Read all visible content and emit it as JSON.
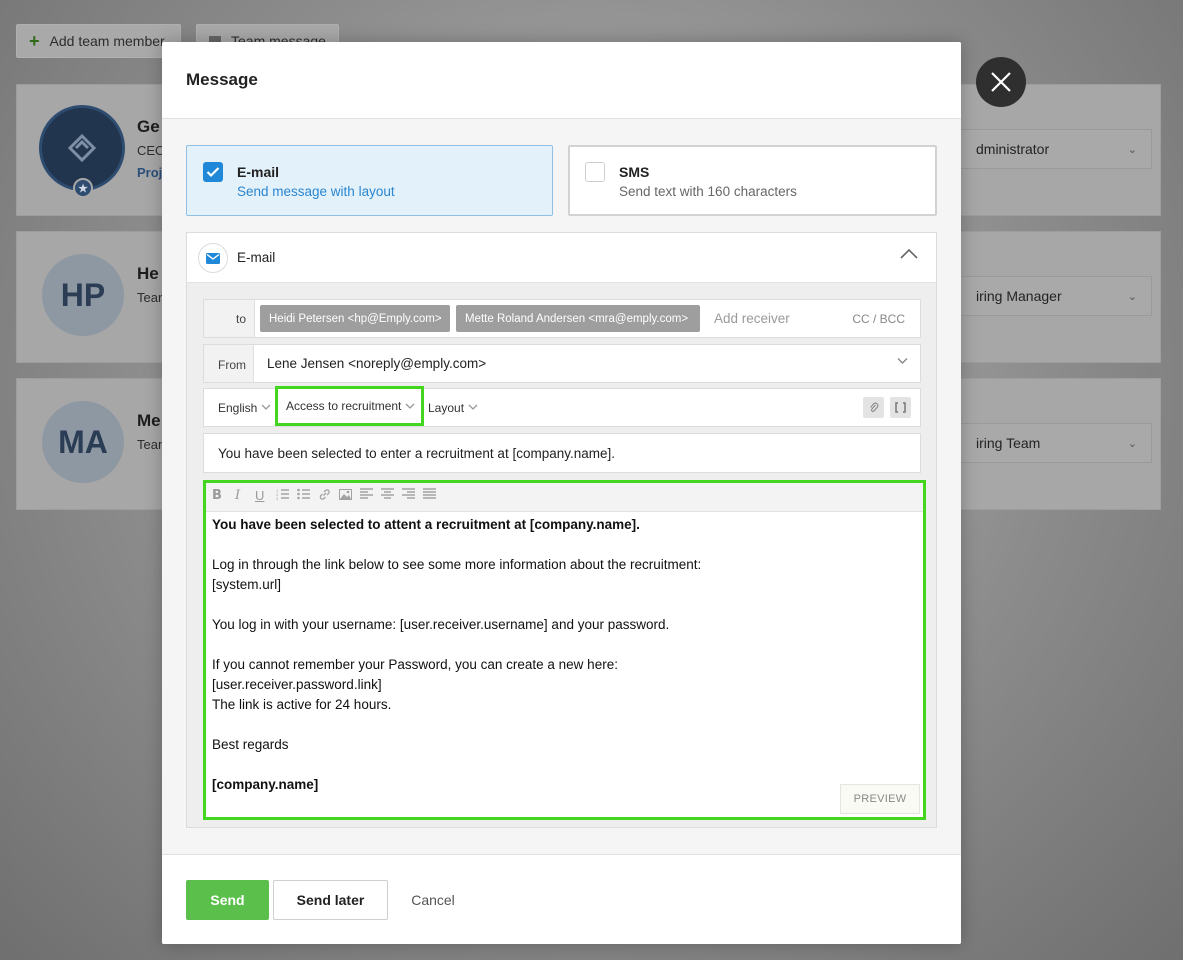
{
  "background": {
    "add_team_member": "Add team member",
    "team_message": "Team message",
    "members": [
      {
        "initials": "",
        "name": "Ge",
        "sub": "CEO",
        "link": "Proj",
        "role": "dministrator"
      },
      {
        "initials": "HP",
        "name": "He",
        "sub": "Tean",
        "link": "",
        "role": "iring Manager"
      },
      {
        "initials": "MA",
        "name": "Me",
        "sub": "Tean",
        "link": "",
        "role": "iring Team"
      }
    ]
  },
  "modal": {
    "title": "Message",
    "options": {
      "email": {
        "title": "E-mail",
        "desc": "Send message with layout",
        "checked": true
      },
      "sms": {
        "title": "SMS",
        "desc": "Send text with 160 characters",
        "checked": false
      }
    },
    "section_title": "E-mail",
    "to_label": "to",
    "recipients": [
      "Heidi Petersen <hp@Emply.com>",
      "Mette Roland Andersen <mra@emply.com>"
    ],
    "add_receiver_placeholder": "Add receiver",
    "cc_bcc": "CC / BCC",
    "from_label": "From",
    "from_value": "Lene Jensen <noreply@emply.com>",
    "language": "English",
    "template": "Access to recruitment",
    "layout": "Layout",
    "subject": "You have been selected to enter a recruitment at [company.name].",
    "body": {
      "line1": "You have been selected to attent a recruitment at [company.name].",
      "line2": "Log in through the link below to see some more information about the recruitment:",
      "line3": "[system.url]",
      "line4": "You log in with your username: [user.receiver.username] and your password.",
      "line5": "If you cannot remember your Password, you can create a new here:",
      "line6": "[user.receiver.password.link]",
      "line7": "The link is active for 24 hours.",
      "line8": "Best regards",
      "line9": "[company.name]"
    },
    "preview": "PREVIEW",
    "send": "Send",
    "send_later": "Send later",
    "cancel": "Cancel"
  },
  "colors": {
    "accent_green": "#43d61e",
    "send_green": "#5bbf4b",
    "email_blue": "#1f88d8"
  }
}
